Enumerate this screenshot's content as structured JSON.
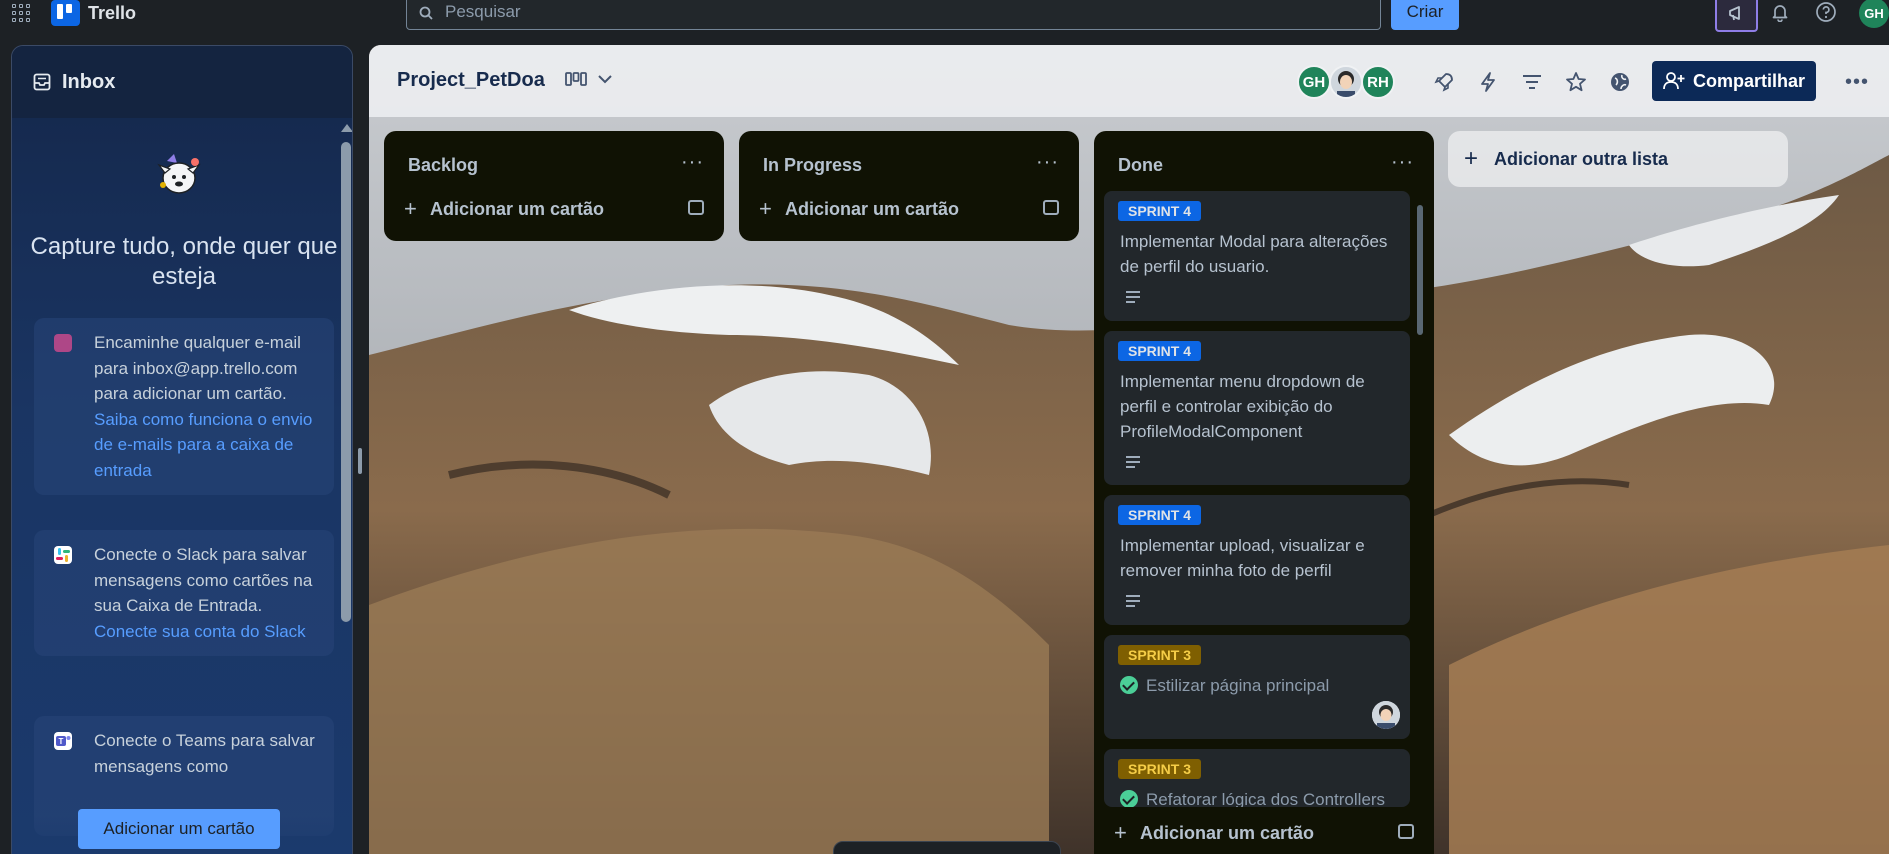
{
  "topbar": {
    "app_name": "Trello",
    "search_placeholder": "Pesquisar",
    "create_label": "Criar",
    "avatar_initials": "GH"
  },
  "inbox": {
    "title": "Inbox",
    "headline": "Capture tudo, onde quer que esteja",
    "cards": [
      {
        "text": "Encaminhe qualquer e-mail para inbox@app.trello.com para adicionar um cartão.",
        "link": "Saiba como funciona o envio de e-mails para a caixa de entrada"
      },
      {
        "text": "Conecte o Slack para salvar mensagens como cartões na sua Caixa de Entrada.",
        "link": "Conecte sua conta do Slack"
      },
      {
        "text": "Conecte o Teams para salvar mensagens como",
        "link": ""
      }
    ],
    "add_card_label": "Adicionar um cartão"
  },
  "board": {
    "name": "Project_PetDoa",
    "members": [
      "GH",
      "RH"
    ],
    "share_label": "Compartilhar",
    "add_list_label": "Adicionar outra lista",
    "lists": [
      {
        "title": "Backlog",
        "add_label": "Adicionar um cartão"
      },
      {
        "title": "In Progress",
        "add_label": "Adicionar um cartão"
      },
      {
        "title": "Done",
        "add_label": "Adicionar um cartão",
        "cards": [
          {
            "label": "SPRINT 4",
            "text": "Implementar Modal para alterações de perfil do usuario."
          },
          {
            "label": "SPRINT 4",
            "text": "Implementar menu dropdown de perfil e controlar exibição do ProfileModalComponent"
          },
          {
            "label": "SPRINT 4",
            "text": "Implementar upload, visualizar e remover minha foto de perfil"
          },
          {
            "label": "SPRINT 3",
            "text": "Estilizar página principal"
          },
          {
            "label": "SPRINT 3",
            "text": "Refatorar lógica dos Controllers"
          }
        ]
      }
    ]
  },
  "colors": {
    "accent": "#579dff",
    "label_blue": "#0c66e4",
    "label_yellow": "#7f5f01",
    "avatar_green": "#1f845a"
  }
}
